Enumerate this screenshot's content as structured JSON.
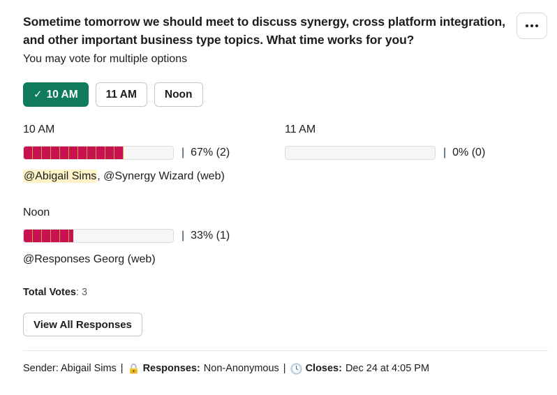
{
  "poll": {
    "question": "Sometime tomorrow we should meet to discuss synergy, cross platform integration, and other important business type topics. What time works for you?",
    "subtitle": "You may vote for multiple options",
    "overflow_icon": "ellipsis-icon",
    "vote_buttons": [
      {
        "label": "10 AM",
        "selected": true,
        "check": "✓"
      },
      {
        "label": "11 AM",
        "selected": false,
        "check": ""
      },
      {
        "label": "Noon",
        "selected": false,
        "check": ""
      }
    ],
    "results": [
      {
        "option": "10 AM",
        "percent_label": "67% (2)",
        "percent": 67,
        "separator": "|",
        "voters_prefix": "@Abigail Sims",
        "voters_rest": ", @Synergy Wizard (web)"
      },
      {
        "option": "11 AM",
        "percent_label": "0% (0)",
        "percent": 0,
        "separator": "|",
        "voters_prefix": "",
        "voters_rest": ""
      },
      {
        "option": "Noon",
        "percent_label": "33% (1)",
        "percent": 33,
        "separator": "|",
        "voters_prefix": "",
        "voters_rest": "@Responses Georg (web)"
      }
    ],
    "totals_label": "Total Votes",
    "totals_value": ": 3",
    "view_all_label": "View All Responses",
    "footer": {
      "sender_text": "Sender: Abigail Sims",
      "sep1": "|",
      "lock_icon": "lock-icon",
      "responses_label": "Responses:",
      "responses_value": "Non-Anonymous",
      "sep2": "|",
      "clock_icon": "clock-icon",
      "closes_label": "Closes:",
      "closes_value": "Dec 24 at 4:05 PM"
    }
  },
  "colors": {
    "accent_green": "#0f7b5a",
    "bar_fill": "#c8114e",
    "bar_stripe": "#d4a04a",
    "highlight": "#fdf2c8",
    "muted": "#616061"
  }
}
